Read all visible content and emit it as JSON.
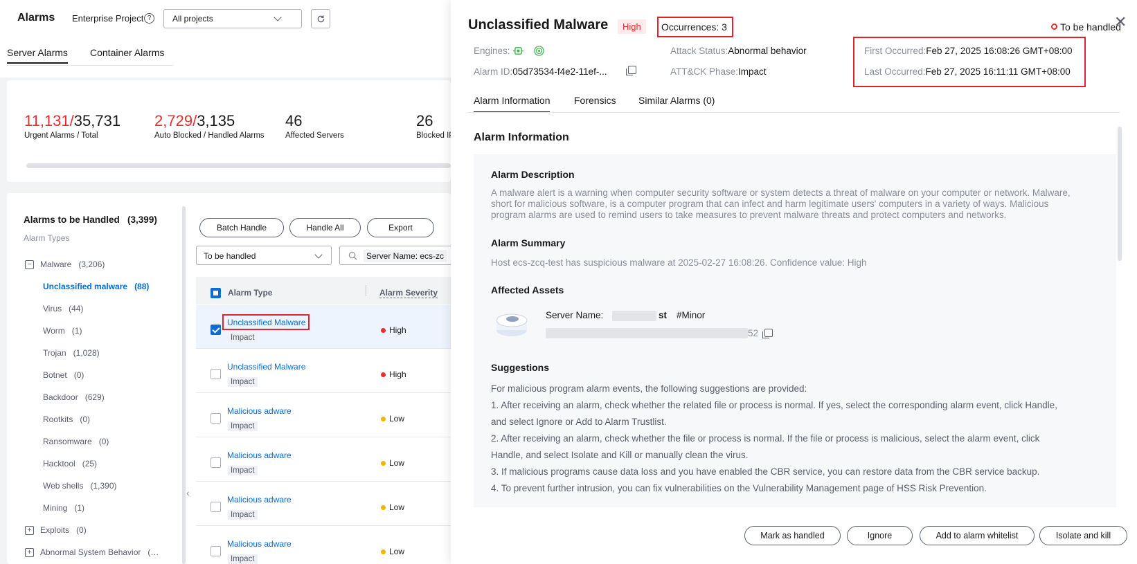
{
  "header": {
    "title": "Alarms",
    "enterprise_project_label": "Enterprise Project",
    "help_glyph": "?",
    "project_value": "All projects"
  },
  "tabs": [
    {
      "label": "Server Alarms",
      "active": true
    },
    {
      "label": "Container Alarms",
      "active": false
    }
  ],
  "stats": {
    "urgent": "11,131",
    "sep1": "/",
    "total": "35,731",
    "urgent_label": "Urgent Alarms",
    "total_label": "/ Total",
    "auto_blocked": "2,729",
    "sep2": "/",
    "handled": "3,135",
    "auto_blocked_label": "Auto Blocked",
    "handled_label": "/ Handled Alarms",
    "affected_servers": "46",
    "affected_servers_label": "Affected Servers",
    "blocked_ips": "26",
    "blocked_ips_label": "Blocked IP"
  },
  "sidebar": {
    "title": "Alarms to be Handled",
    "count": "(3,399)",
    "subtitle": "Alarm Types",
    "groups": [
      {
        "label": "Malware",
        "count": "(3,206)",
        "glyph": "−"
      },
      {
        "label": "Exploits",
        "count": "(0)",
        "glyph": "+"
      },
      {
        "label": "Abnormal System Behavior",
        "count": "(…",
        "glyph": "+"
      }
    ],
    "items": [
      {
        "label": "Unclassified malware",
        "count": "(88)"
      },
      {
        "label": "Virus",
        "count": "(44)"
      },
      {
        "label": "Worm",
        "count": "(1)"
      },
      {
        "label": "Trojan",
        "count": "(1,028)"
      },
      {
        "label": "Botnet",
        "count": "(0)"
      },
      {
        "label": "Backdoor",
        "count": "(629)"
      },
      {
        "label": "Rootkits",
        "count": "(0)"
      },
      {
        "label": "Ransomware",
        "count": "(0)"
      },
      {
        "label": "Hacktool",
        "count": "(25)"
      },
      {
        "label": "Web shells",
        "count": "(1,390)"
      },
      {
        "label": "Mining",
        "count": "(1)"
      }
    ],
    "collapse_glyph": "‹"
  },
  "toolbar": {
    "batch_handle": "Batch Handle",
    "handle_all": "Handle All",
    "export": "Export",
    "status_filter": "To be handled",
    "search_tag": "Server Name: ecs-zc"
  },
  "table": {
    "col_type": "Alarm Type",
    "col_severity": "Alarm Severity",
    "rows": [
      {
        "type": "Unclassified Malware",
        "tag": "Impact",
        "severity": "High",
        "sev_color": "#e62e2e"
      },
      {
        "type": "Unclassified Malware",
        "tag": "Impact",
        "severity": "High",
        "sev_color": "#e62e2e"
      },
      {
        "type": "Malicious adware",
        "tag": "Impact",
        "severity": "Low",
        "sev_color": "#f6b200"
      },
      {
        "type": "Malicious adware",
        "tag": "Impact",
        "severity": "Low",
        "sev_color": "#f6b200"
      },
      {
        "type": "Malicious adware",
        "tag": "Impact",
        "severity": "Low",
        "sev_color": "#f6b200"
      },
      {
        "type": "Malicious adware",
        "tag": "Impact",
        "severity": "Low",
        "sev_color": "#f6b200"
      }
    ]
  },
  "drawer": {
    "title": "Unclassified Malware",
    "severity": "High",
    "occurrences": "Occurrences: 3",
    "status": "To be handled",
    "close_glyph": "✕",
    "engines_label": "Engines:",
    "alarm_id_label": "Alarm ID:",
    "alarm_id_value": "05d73534-f4e2-11ef-...",
    "attack_status_label": "Attack Status:",
    "attack_status_value": "Abnormal behavior",
    "attck_label": "ATT&CK Phase:",
    "attck_value": "Impact",
    "first_label": "First Occurred:",
    "first_value": "Feb 27, 2025 16:08:26 GMT+08:00",
    "last_label": "Last Occurred:",
    "last_value": "Feb 27, 2025 16:11:11 GMT+08:00",
    "tabs": [
      "Alarm Information",
      "Forensics",
      "Similar Alarms (0)"
    ],
    "section_title": "Alarm Information",
    "desc_title": "Alarm Description",
    "desc_lines": [
      "A malware alert is a warning when computer security software or system detects a threat of malware on your computer or network. Malware,",
      "short for malicious software, is a computer program that can infect and harm legitimate users' computers in a variety of ways. Malicious",
      "program alarms are used to remind users to take measures to prevent malware threats and protect computers and networks."
    ],
    "summary_title": "Alarm Summary",
    "summary_text": "Host ecs-zcq-test has suspicious malware at 2025-02-27 16:08:26. Confidence value: High",
    "assets_title": "Affected Assets",
    "server_name_label": "Server Name:",
    "server_name_tail": "st",
    "server_tag": "#Minor",
    "ip_tail": "52",
    "suggestions_title": "Suggestions",
    "suggestion_lines": [
      "For malicious program alarm events, the following suggestions are provided:",
      "1. After receiving an alarm, check whether the related file or process is normal. If yes, select the corresponding alarm event, click Handle,",
      "and select Ignore or Add to Alarm Trustlist.",
      "2. After receiving an alarm, check whether the file or process is normal. If the file or process is malicious, select the alarm event, click",
      "Handle, and select Isolate and Kill or manually clean the virus.",
      "3. If malicious programs cause data loss and you have enabled the CBR service, you can restore data from the CBR service backup.",
      "4. To prevent further intrusion, you can fix vulnerabilities on the Vulnerability Management page of HSS Risk Prevention."
    ],
    "buttons": {
      "mark_handled": "Mark as handled",
      "ignore": "Ignore",
      "whitelist": "Add to alarm whitelist",
      "isolate": "Isolate and kill"
    }
  },
  "colors": {
    "accent_blue": "#0a6cd4",
    "alert_red": "#e62e2e",
    "low_yellow": "#f6b200",
    "engine_green": "#3fb34f"
  }
}
